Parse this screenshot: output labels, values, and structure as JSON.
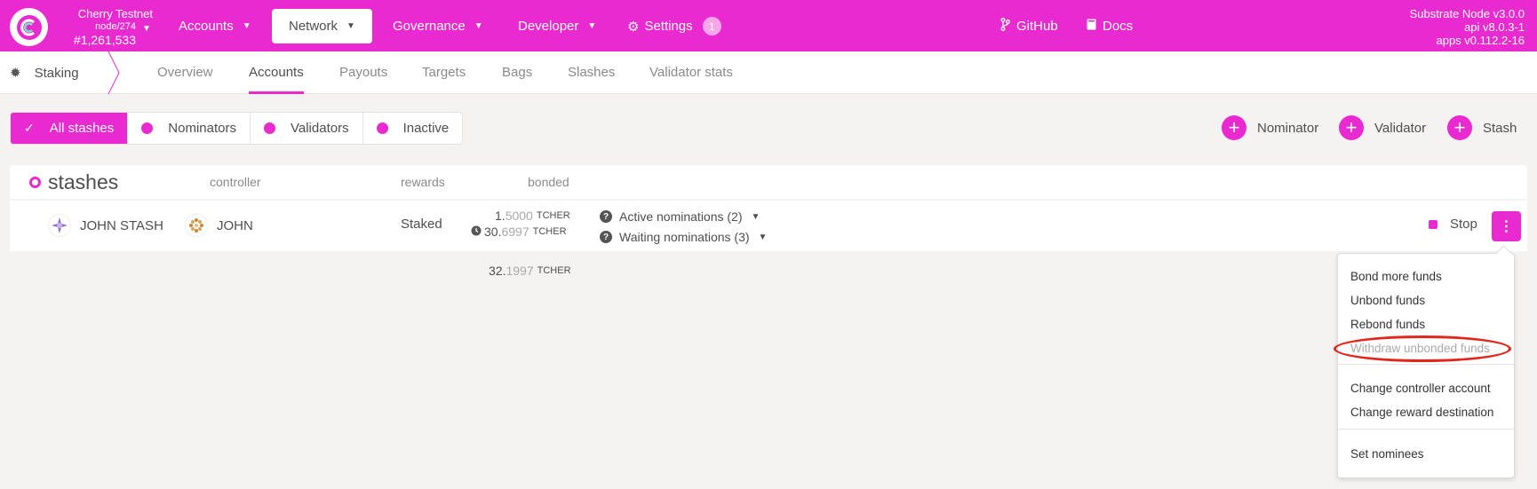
{
  "header": {
    "chain_name": "Cherry Testnet",
    "node": "node/274",
    "block": "#1,261,533",
    "nav": {
      "accounts": "Accounts",
      "network": "Network",
      "governance": "Governance",
      "developer": "Developer",
      "settings": "Settings",
      "settings_badge": "1",
      "github": "GitHub",
      "docs": "Docs"
    },
    "version": {
      "node": "Substrate Node v3.0.0",
      "api": "api v8.0.3-1",
      "apps": "apps v0.112.2-16"
    }
  },
  "subnav": {
    "section": "Staking",
    "tabs": [
      "Overview",
      "Accounts",
      "Payouts",
      "Targets",
      "Bags",
      "Slashes",
      "Validator stats"
    ],
    "active_tab": "Accounts"
  },
  "filters": [
    "All stashes",
    "Nominators",
    "Validators",
    "Inactive"
  ],
  "actions": [
    "Nominator",
    "Validator",
    "Stash"
  ],
  "table": {
    "headers": {
      "stashes": "stashes",
      "controller": "controller",
      "rewards": "rewards",
      "bonded": "bonded"
    },
    "row": {
      "stash": "JOHN STASH",
      "controller": "JOHN",
      "rewards": "Staked",
      "bonded_int": "1.",
      "bonded_dec": "5000",
      "bonded_unit": "TCHER",
      "unbonding_int": "30.",
      "unbonding_dec": "6997",
      "unbonding_unit": "TCHER",
      "active_nominations": "Active nominations (2)",
      "waiting_nominations": "Waiting nominations (3)",
      "stop": "Stop"
    },
    "total_int": "32.",
    "total_dec": "1997",
    "total_unit": "TCHER"
  },
  "menu": {
    "items": [
      "Bond more funds",
      "Unbond funds",
      "Rebond funds",
      "Withdraw unbonded funds",
      "Change controller account",
      "Change reward destination",
      "Set nominees"
    ]
  },
  "colors": {
    "accent": "#e82ad0",
    "highlight": "#e3261b"
  }
}
